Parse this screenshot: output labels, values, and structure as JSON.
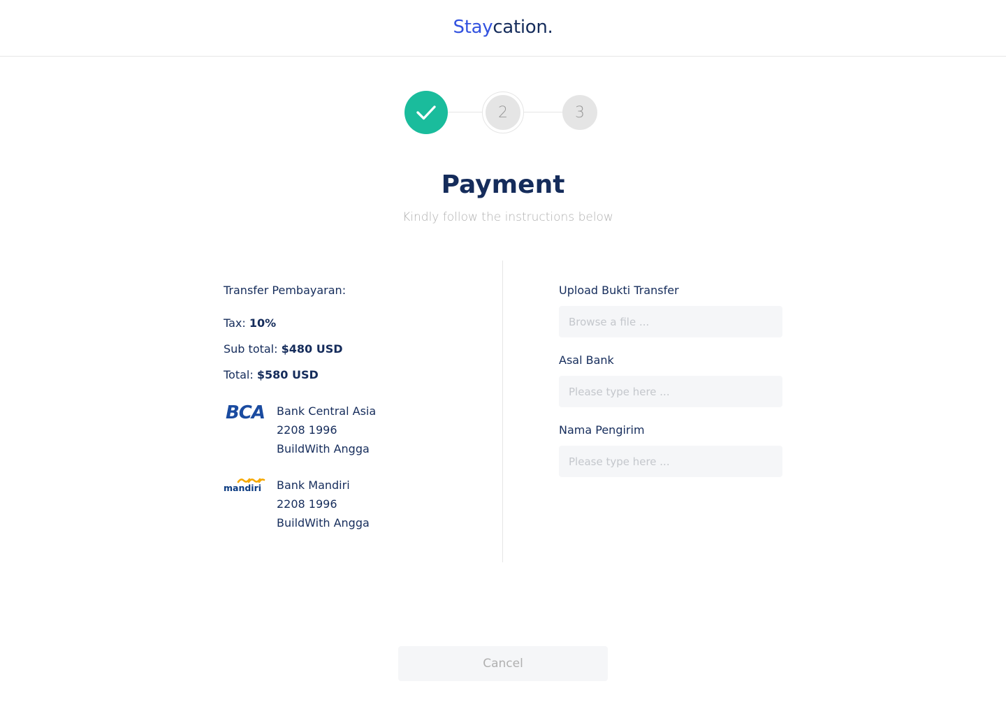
{
  "header": {
    "logo_part1": "Stay",
    "logo_part2": "cation."
  },
  "stepper": {
    "steps": [
      {
        "state": "done",
        "icon": "check-icon"
      },
      {
        "state": "current",
        "label": "2"
      },
      {
        "state": "upcoming",
        "label": "3"
      }
    ]
  },
  "page": {
    "title": "Payment",
    "subtitle": "Kindly follow the instructions below"
  },
  "transfer": {
    "heading": "Transfer Pembayaran:",
    "tax_label": "Tax:",
    "tax_value": "10%",
    "subtotal_label": "Sub total:",
    "subtotal_value": "$480 USD",
    "total_label": "Total:",
    "total_value": "$580 USD"
  },
  "banks": [
    {
      "logo": "bca-logo",
      "logo_text": "BCA",
      "name": "Bank Central Asia",
      "account": "2208 1996",
      "holder": "BuildWith Angga"
    },
    {
      "logo": "mandiri-logo",
      "logo_text": "mandiri",
      "name": "Bank Mandiri",
      "account": "2208 1996",
      "holder": "BuildWith Angga"
    }
  ],
  "form": {
    "upload_label": "Upload Bukti Transfer",
    "upload_placeholder": "Browse a file ...",
    "bank_label": "Asal Bank",
    "bank_placeholder": "Please type here ...",
    "sender_label": "Nama Pengirim",
    "sender_placeholder": "Please type here ..."
  },
  "actions": {
    "cancel_label": "Cancel"
  },
  "colors": {
    "brand_blue": "#3252df",
    "navy": "#152c5b",
    "success": "#1abc9c",
    "muted": "#b0b0b0",
    "input_bg": "#f5f6f8"
  }
}
